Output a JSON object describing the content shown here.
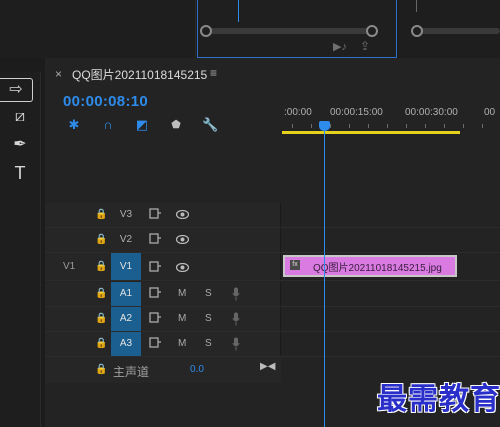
{
  "sequence": {
    "tab_close": "×",
    "tab_title": "QQ图片20211018145215",
    "tab_menu": "≡",
    "timecode": "00:00:08:10"
  },
  "ruler": {
    "labels": [
      ":00:00",
      "00:00:15:00",
      "00:00:30:00",
      "00"
    ]
  },
  "tracks": {
    "video": [
      {
        "label": "V3",
        "source": "",
        "targeted": false
      },
      {
        "label": "V2",
        "source": "",
        "targeted": false
      },
      {
        "label": "V1",
        "source": "V1",
        "targeted": true
      }
    ],
    "audio": [
      {
        "label": "A1",
        "mute": "M",
        "solo": "S",
        "targeted": true
      },
      {
        "label": "A2",
        "mute": "M",
        "solo": "S",
        "targeted": true
      },
      {
        "label": "A3",
        "mute": "M",
        "solo": "S",
        "targeted": true
      }
    ],
    "master": {
      "label": "主声道",
      "value": "0.0"
    }
  },
  "clip": {
    "fx": "fx",
    "name": "QQ图片20211018145215.jpg",
    "color": "#d97be0"
  },
  "watermark": "最需教育",
  "colors": {
    "accent": "#2d8ceb",
    "work_area": "#e5d21c",
    "track_target": "#1a5f8f"
  }
}
